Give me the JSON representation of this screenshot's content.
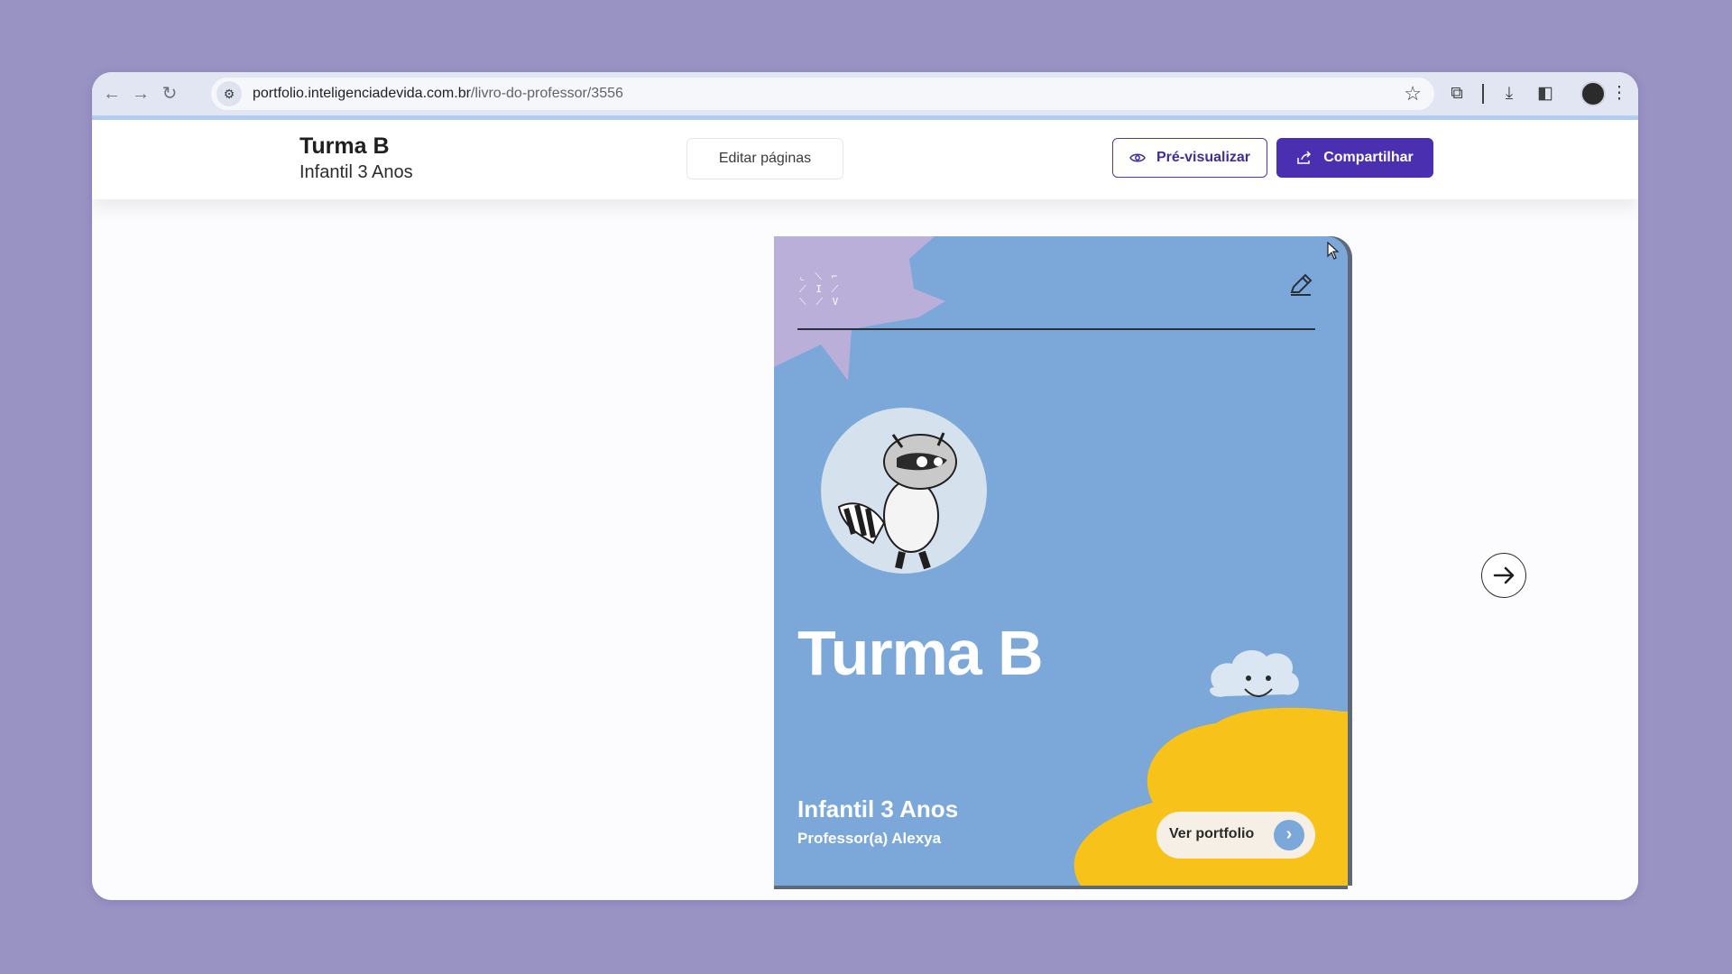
{
  "browser": {
    "url_host": "portfolio.inteligenciadevida.com.br",
    "url_path": "/livro-do-professor/3556",
    "icons": [
      "back-icon",
      "forward-icon",
      "reload-icon",
      "site-info-icon",
      "star-icon",
      "extensions-icon",
      "download-icon",
      "side-panel-icon",
      "profile-avatar",
      "menu-icon"
    ]
  },
  "header": {
    "title": "Turma B",
    "subtitle": "Infantil 3 Anos",
    "edit_pages_label": "Editar páginas",
    "preview_label": "Pré-visualizar",
    "share_label": "Compartilhar"
  },
  "card": {
    "title": "Turma B",
    "grade": "Infantil 3 Anos",
    "teacher": "Professor(a) Alexya",
    "cta_label": "Ver portfolio",
    "colors": {
      "background": "#7ba8d8",
      "lilac": "#b9afd8",
      "yellow": "#f7c21a",
      "cloud": "#dbe6f3"
    }
  },
  "colors": {
    "page_background": "#9993c4",
    "accent": "#4a2fb0"
  }
}
